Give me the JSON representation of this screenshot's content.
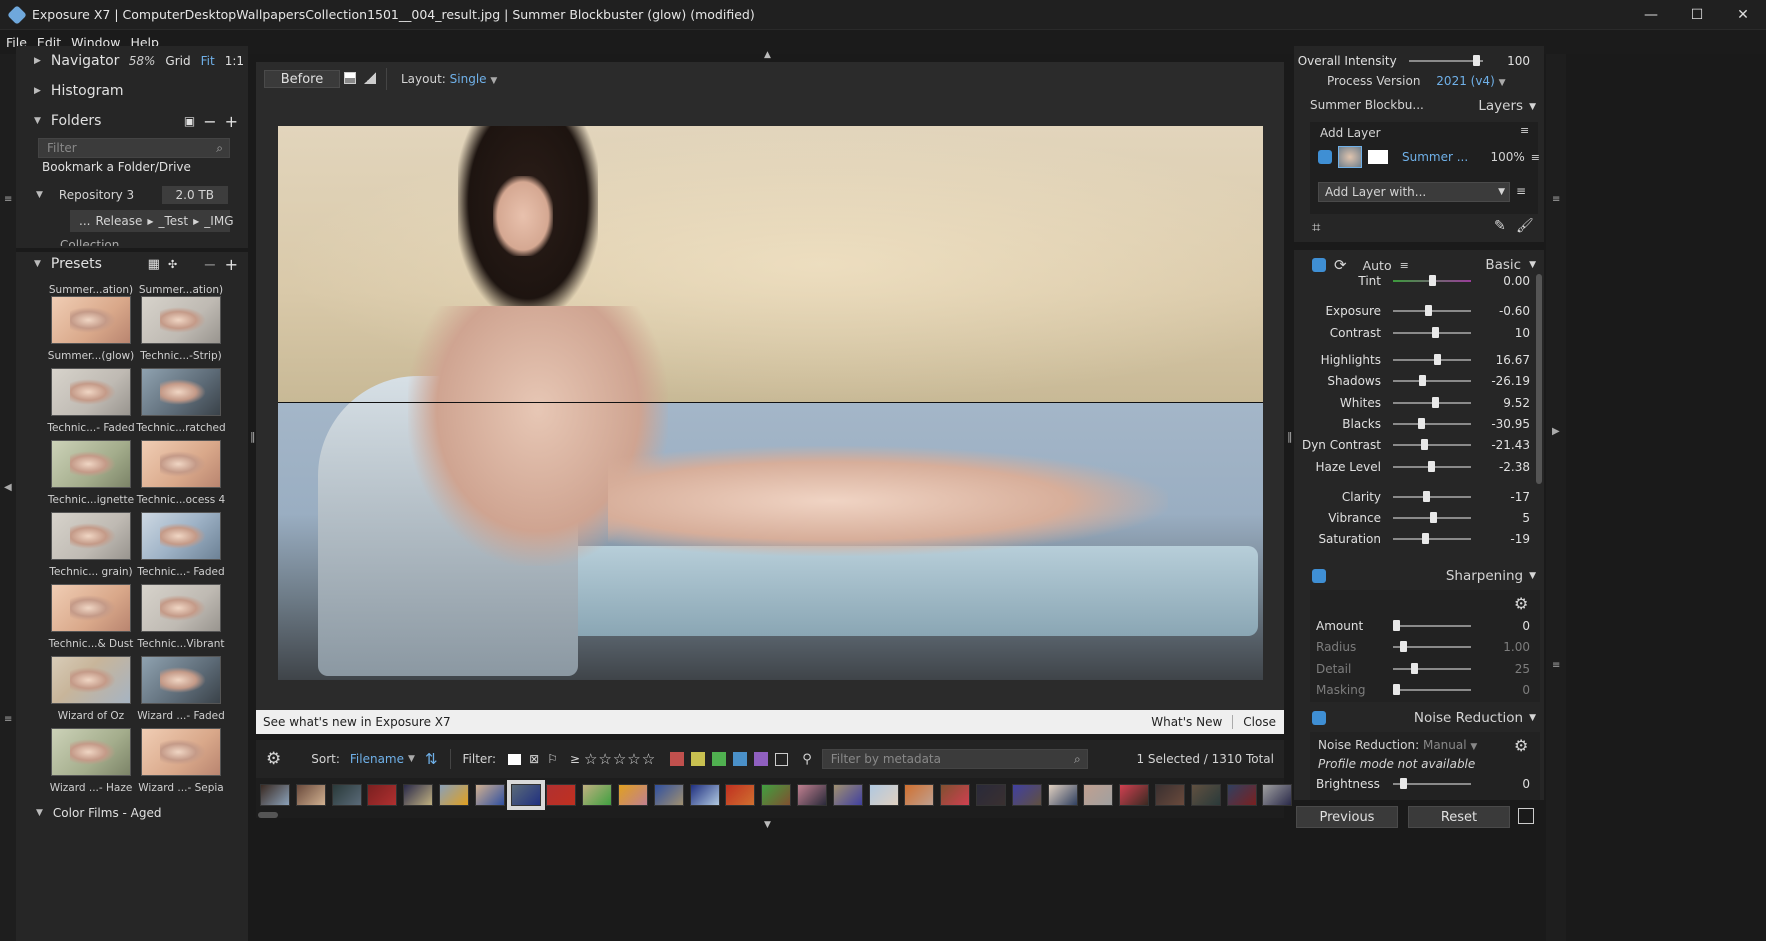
{
  "window": {
    "title": "Exposure X7 | ComputerDesktopWallpapersCollection1501__004_result.jpg | Summer Blockbuster (glow) (modified)"
  },
  "menu": [
    "File",
    "Edit",
    "Window",
    "Help"
  ],
  "navigator": {
    "label": "Navigator",
    "zoom": "58%",
    "grid": "Grid",
    "fit": "Fit",
    "one": "1:1"
  },
  "histogram": {
    "label": "Histogram"
  },
  "folders": {
    "label": "Folders",
    "filter_placeholder": "Filter",
    "bookmark": "Bookmark a Folder/Drive",
    "repo": "Repository 3",
    "repo_size": "2.0 TB",
    "path": [
      "...",
      "Release",
      "_Test",
      "_IMG"
    ],
    "collection": "Collection"
  },
  "presets": {
    "label": "Presets",
    "group_bottom": "Color Films - Aged",
    "cells": [
      [
        "Summer...ation)",
        "Summer...ation)"
      ],
      [
        "Summer...(glow)",
        "Technic...-Strip)"
      ],
      [
        "Technic...- Faded",
        "Technic...ratched"
      ],
      [
        "Technic...ignette",
        "Technic...ocess 4"
      ],
      [
        "Technic... grain)",
        "Technic...- Faded"
      ],
      [
        "Technic...& Dust",
        "Technic...Vibrant"
      ],
      [
        "Wizard of Oz",
        "Wizard ...- Faded"
      ],
      [
        "Wizard ...- Haze",
        "Wizard ...- Sepia"
      ]
    ]
  },
  "viewer": {
    "before": "Before",
    "layout_label": "Layout:",
    "layout_value": "Single"
  },
  "notice": {
    "text": "See what's new in Exposure X7",
    "whatsnew": "What's New",
    "close": "Close"
  },
  "filmstrip": {
    "sort_label": "Sort:",
    "sort_value": "Filename",
    "filter_label": "Filter:",
    "metadata_placeholder": "Filter by metadata",
    "count": "1 Selected / 1310 Total",
    "stars_prefix": "≥",
    "color_labels": [
      "#c0504d",
      "#c8c050",
      "#50b050",
      "#4a90c8",
      "#9060c0"
    ]
  },
  "right": {
    "overall_intensity_label": "Overall Intensity",
    "overall_intensity": "100",
    "overall_intensity_level": 0.95,
    "process_label": "Process Version",
    "process_value": "2021 (v4)",
    "preset_name": "Summer Blockbu...",
    "layers_label": "Layers",
    "add_layer": "Add Layer",
    "layer_name": "Summer ...",
    "layer_opacity": "100%",
    "add_layer_with": "Add Layer with...",
    "auto": "Auto",
    "basic": "Basic",
    "tint": {
      "name": "Tint",
      "value": "0.00",
      "level": 0.5
    },
    "basic_rows": [
      {
        "name": "Exposure",
        "value": "-0.60",
        "level": 0.45
      },
      {
        "name": "Contrast",
        "value": "10",
        "level": 0.55
      },
      {
        "name": "Highlights",
        "value": "16.67",
        "level": 0.58
      },
      {
        "name": "Shadows",
        "value": "-26.19",
        "level": 0.37
      },
      {
        "name": "Whites",
        "value": "9.52",
        "level": 0.55
      },
      {
        "name": "Blacks",
        "value": "-30.95",
        "level": 0.35
      },
      {
        "name": "Dyn Contrast",
        "value": "-21.43",
        "level": 0.39
      },
      {
        "name": "Haze Level",
        "value": "-2.38",
        "level": 0.49
      },
      {
        "name": "Clarity",
        "value": "-17",
        "level": 0.42
      },
      {
        "name": "Vibrance",
        "value": "5",
        "level": 0.52
      },
      {
        "name": "Saturation",
        "value": "-19",
        "level": 0.41
      }
    ],
    "sharpening": "Sharpening",
    "sharp_rows": [
      {
        "name": "Amount",
        "value": "0",
        "level": 0.0,
        "dim": false
      },
      {
        "name": "Radius",
        "value": "1.00",
        "level": 0.1,
        "dim": true
      },
      {
        "name": "Detail",
        "value": "25",
        "level": 0.25,
        "dim": true
      },
      {
        "name": "Masking",
        "value": "0",
        "level": 0.0,
        "dim": true
      }
    ],
    "noise": "Noise Reduction",
    "noise_label": "Noise Reduction:",
    "noise_mode": "Manual",
    "profile_na": "Profile mode not available",
    "brightness": "Brightness",
    "brightness_value": "0",
    "brightness_level": 0.1,
    "previous": "Previous",
    "reset": "Reset"
  }
}
